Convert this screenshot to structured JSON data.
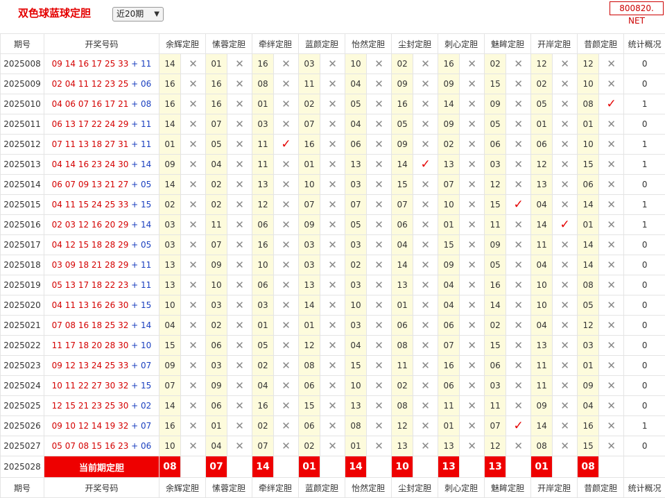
{
  "header": {
    "title": "双色球蓝球定胆",
    "period_select": "近20期",
    "brand": "800820. NET"
  },
  "columns": {
    "issue": "期号",
    "numbers": "开奖号码",
    "experts": [
      "余辉定胆",
      "愫蓉定胆",
      "牵绊定胆",
      "蓝颜定胆",
      "怡然定胆",
      "尘封定胆",
      "刺心定胆",
      "魅眸定胆",
      "开岸定胆",
      "昔颜定胆"
    ],
    "stat": "统计概况"
  },
  "rows": [
    {
      "issue": "2025008",
      "reds": "09 14 16 17 25 33",
      "blue": "11",
      "picks": [
        "14",
        "01",
        "16",
        "03",
        "10",
        "02",
        "16",
        "02",
        "12",
        "12"
      ],
      "hits": [
        0,
        0,
        0,
        0,
        0,
        0,
        0,
        0,
        0,
        0
      ],
      "count": "0"
    },
    {
      "issue": "2025009",
      "reds": "02 04 11 12 23 25",
      "blue": "06",
      "picks": [
        "16",
        "16",
        "08",
        "11",
        "04",
        "09",
        "09",
        "15",
        "02",
        "10"
      ],
      "hits": [
        0,
        0,
        0,
        0,
        0,
        0,
        0,
        0,
        0,
        0
      ],
      "count": "0"
    },
    {
      "issue": "2025010",
      "reds": "04 06 07 16 17 21",
      "blue": "08",
      "picks": [
        "16",
        "16",
        "01",
        "02",
        "05",
        "16",
        "14",
        "09",
        "05",
        "08"
      ],
      "hits": [
        0,
        0,
        0,
        0,
        0,
        0,
        0,
        0,
        0,
        1
      ],
      "count": "1"
    },
    {
      "issue": "2025011",
      "reds": "06 13 17 22 24 29",
      "blue": "11",
      "picks": [
        "14",
        "07",
        "03",
        "07",
        "04",
        "05",
        "09",
        "05",
        "01",
        "01"
      ],
      "hits": [
        0,
        0,
        0,
        0,
        0,
        0,
        0,
        0,
        0,
        0
      ],
      "count": "0"
    },
    {
      "issue": "2025012",
      "reds": "07 11 13 18 27 31",
      "blue": "11",
      "picks": [
        "01",
        "05",
        "11",
        "16",
        "06",
        "09",
        "02",
        "06",
        "06",
        "10"
      ],
      "hits": [
        0,
        0,
        1,
        0,
        0,
        0,
        0,
        0,
        0,
        0
      ],
      "count": "1"
    },
    {
      "issue": "2025013",
      "reds": "04 14 16 23 24 30",
      "blue": "14",
      "picks": [
        "09",
        "04",
        "11",
        "01",
        "13",
        "14",
        "13",
        "03",
        "12",
        "15"
      ],
      "hits": [
        0,
        0,
        0,
        0,
        0,
        1,
        0,
        0,
        0,
        0
      ],
      "count": "1"
    },
    {
      "issue": "2025014",
      "reds": "06 07 09 13 21 27",
      "blue": "05",
      "picks": [
        "14",
        "02",
        "13",
        "10",
        "03",
        "15",
        "07",
        "12",
        "13",
        "06"
      ],
      "hits": [
        0,
        0,
        0,
        0,
        0,
        0,
        0,
        0,
        0,
        0
      ],
      "count": "0"
    },
    {
      "issue": "2025015",
      "reds": "04 11 15 24 25 33",
      "blue": "15",
      "picks": [
        "02",
        "02",
        "12",
        "07",
        "07",
        "07",
        "10",
        "15",
        "04",
        "14"
      ],
      "hits": [
        0,
        0,
        0,
        0,
        0,
        0,
        0,
        1,
        0,
        0
      ],
      "count": "1"
    },
    {
      "issue": "2025016",
      "reds": "02 03 12 16 20 29",
      "blue": "14",
      "picks": [
        "03",
        "11",
        "06",
        "09",
        "05",
        "06",
        "01",
        "11",
        "14",
        "01"
      ],
      "hits": [
        0,
        0,
        0,
        0,
        0,
        0,
        0,
        0,
        1,
        0
      ],
      "count": "1"
    },
    {
      "issue": "2025017",
      "reds": "04 12 15 18 28 29",
      "blue": "05",
      "picks": [
        "03",
        "07",
        "16",
        "03",
        "03",
        "04",
        "15",
        "09",
        "11",
        "14"
      ],
      "hits": [
        0,
        0,
        0,
        0,
        0,
        0,
        0,
        0,
        0,
        0
      ],
      "count": "0"
    },
    {
      "issue": "2025018",
      "reds": "03 09 18 21 28 29",
      "blue": "11",
      "picks": [
        "13",
        "09",
        "10",
        "03",
        "02",
        "14",
        "09",
        "05",
        "04",
        "14"
      ],
      "hits": [
        0,
        0,
        0,
        0,
        0,
        0,
        0,
        0,
        0,
        0
      ],
      "count": "0"
    },
    {
      "issue": "2025019",
      "reds": "05 13 17 18 22 23",
      "blue": "11",
      "picks": [
        "13",
        "10",
        "06",
        "13",
        "03",
        "13",
        "04",
        "16",
        "10",
        "08"
      ],
      "hits": [
        0,
        0,
        0,
        0,
        0,
        0,
        0,
        0,
        0,
        0
      ],
      "count": "0"
    },
    {
      "issue": "2025020",
      "reds": "04 11 13 16 26 30",
      "blue": "15",
      "picks": [
        "10",
        "03",
        "03",
        "14",
        "10",
        "01",
        "04",
        "14",
        "10",
        "05"
      ],
      "hits": [
        0,
        0,
        0,
        0,
        0,
        0,
        0,
        0,
        0,
        0
      ],
      "count": "0"
    },
    {
      "issue": "2025021",
      "reds": "07 08 16 18 25 32",
      "blue": "14",
      "picks": [
        "04",
        "02",
        "01",
        "01",
        "03",
        "06",
        "06",
        "02",
        "04",
        "12"
      ],
      "hits": [
        0,
        0,
        0,
        0,
        0,
        0,
        0,
        0,
        0,
        0
      ],
      "count": "0"
    },
    {
      "issue": "2025022",
      "reds": "11 17 18 20 28 30",
      "blue": "10",
      "picks": [
        "15",
        "06",
        "05",
        "12",
        "04",
        "08",
        "07",
        "15",
        "13",
        "03"
      ],
      "hits": [
        0,
        0,
        0,
        0,
        0,
        0,
        0,
        0,
        0,
        0
      ],
      "count": "0"
    },
    {
      "issue": "2025023",
      "reds": "09 12 13 24 25 33",
      "blue": "07",
      "picks": [
        "09",
        "03",
        "02",
        "08",
        "15",
        "11",
        "16",
        "06",
        "11",
        "01"
      ],
      "hits": [
        0,
        0,
        0,
        0,
        0,
        0,
        0,
        0,
        0,
        0
      ],
      "count": "0"
    },
    {
      "issue": "2025024",
      "reds": "10 11 22 27 30 32",
      "blue": "15",
      "picks": [
        "07",
        "09",
        "04",
        "06",
        "10",
        "02",
        "06",
        "03",
        "11",
        "09"
      ],
      "hits": [
        0,
        0,
        0,
        0,
        0,
        0,
        0,
        0,
        0,
        0
      ],
      "count": "0"
    },
    {
      "issue": "2025025",
      "reds": "12 15 21 23 25 30",
      "blue": "02",
      "picks": [
        "14",
        "06",
        "16",
        "15",
        "13",
        "08",
        "11",
        "11",
        "09",
        "04"
      ],
      "hits": [
        0,
        0,
        0,
        0,
        0,
        0,
        0,
        0,
        0,
        0
      ],
      "count": "0"
    },
    {
      "issue": "2025026",
      "reds": "09 10 12 14 19 32",
      "blue": "07",
      "picks": [
        "16",
        "01",
        "02",
        "06",
        "08",
        "12",
        "01",
        "07",
        "14",
        "16"
      ],
      "hits": [
        0,
        0,
        0,
        0,
        0,
        0,
        0,
        1,
        0,
        0
      ],
      "count": "1"
    },
    {
      "issue": "2025027",
      "reds": "05 07 08 15 16 23",
      "blue": "06",
      "picks": [
        "10",
        "04",
        "07",
        "02",
        "01",
        "13",
        "13",
        "12",
        "08",
        "15"
      ],
      "hits": [
        0,
        0,
        0,
        0,
        0,
        0,
        0,
        0,
        0,
        0
      ],
      "count": "0"
    }
  ],
  "current": {
    "issue": "2025028",
    "label": "当前期定胆",
    "picks": [
      "08",
      "07",
      "14",
      "01",
      "14",
      "10",
      "13",
      "13",
      "01",
      "08"
    ]
  },
  "symbols": {
    "miss": "✕",
    "hit": "✓",
    "plus": "+"
  },
  "colors": {
    "red": "#e40000",
    "blue": "#1a3fbf",
    "pick_bg": "#fdfbdc"
  }
}
